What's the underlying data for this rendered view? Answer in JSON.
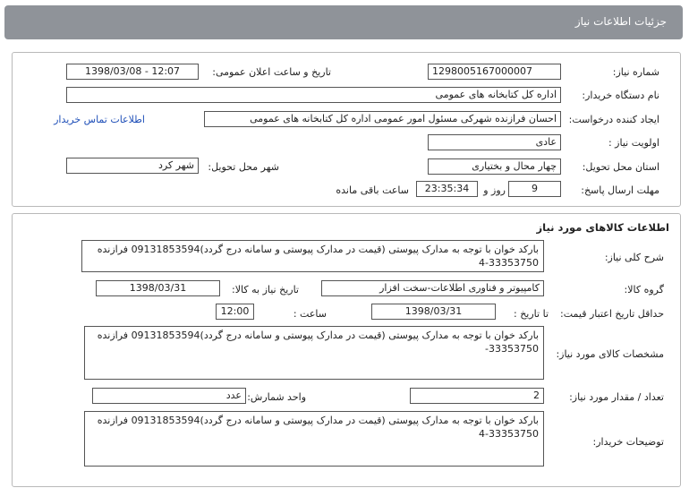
{
  "header": {
    "title": "جزئیات اطلاعات نیاز"
  },
  "info": {
    "need_number_label": "شماره نیاز:",
    "need_number": "1298005167000007",
    "announce_label": "تاریخ و ساعت اعلان عمومی:",
    "announce_value": "1398/03/08 - 12:07",
    "buyer_org_label": "نام دستگاه خریدار:",
    "buyer_org": "اداره کل کتابخانه های عمومی",
    "requester_label": "ایجاد کننده درخواست:",
    "requester": "احسان فرازنده شهرکی مسئول امور عمومی اداره کل کتابخانه های عمومی",
    "contact_link": "اطلاعات تماس خریدار",
    "priority_label": "اولویت نیاز :",
    "priority": "عادی",
    "province_label": "استان محل تحویل:",
    "province": "چهار محال و بختیاری",
    "city_label": "شهر محل تحویل:",
    "city": "شهر کرد",
    "deadline_label": "مهلت ارسال پاسخ:",
    "days": "9",
    "days_label": "روز و",
    "time_remaining": "23:35:34",
    "remaining_label": "ساعت باقی مانده"
  },
  "goods": {
    "section_title": "اطلاعات کالاهای مورد نیاز",
    "description_label": "شرح کلی نیاز:",
    "description": "بارکد خوان با توجه به مدارک پیوستی (قیمت در مدارک پیوستی و سامانه درج گردد)09131853594 فرازنده 33353750-4",
    "group_label": "گروه کالا:",
    "group": "کامپیوتر و فناوری اطلاعات-سخت افزار",
    "need_date_label": "تاریخ نیاز به کالا:",
    "need_date": "1398/03/31",
    "validity_label": "حداقل تاریخ اعتبار قیمت:",
    "until_date_label": "تا تاریخ :",
    "until_date": "1398/03/31",
    "time_label": "ساعت :",
    "time": "12:00",
    "specs_label": "مشخصات کالای مورد نیاز:",
    "specs": "بارکد خوان با توجه به مدارک پیوستی (قیمت در مدارک پیوستی و سامانه درج گردد)09131853594 فرازنده 33353750-",
    "quantity_label": "تعداد / مقدار مورد نیاز:",
    "quantity": "2",
    "unit_label": "واحد شمارش:",
    "unit": "عدد",
    "buyer_notes_label": "توضیحات خریدار:",
    "buyer_notes": "بارکد خوان با توجه به مدارک پیوستی (قیمت در مدارک پیوستی و سامانه درج گردد)09131853594 فرازنده 33353750-4"
  }
}
